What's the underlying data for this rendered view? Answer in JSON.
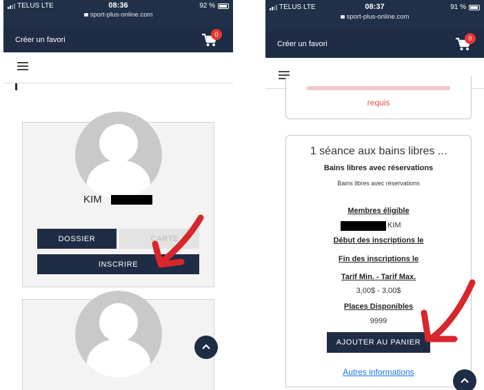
{
  "left": {
    "status": {
      "carrier": "TELUS LTE",
      "time": "08:36",
      "battery": "92 %",
      "url": "sport-plus-online.com"
    },
    "nav": {
      "favorite_label": "Créer un favori",
      "cart_count": "0"
    },
    "member": {
      "name": "KIM"
    },
    "buttons": {
      "dossier": "DOSSIER",
      "carte": "CARTE",
      "inscrire": "INSCRIRE"
    }
  },
  "right": {
    "status": {
      "carrier": "TELUS LTE",
      "time": "08:37",
      "battery": "91 %",
      "url": "sport-plus-online.com"
    },
    "nav": {
      "favorite_label": "Créer un favori",
      "cart_count": "0"
    },
    "top_card": {
      "required_text": "requis"
    },
    "activity": {
      "title": "1 séance aux bains libres ...",
      "subtitle": "Bains libres avec réservations",
      "description": "Bains libres avec réservations",
      "members_label": "Membres éligible",
      "member_name": "KIM",
      "start_label": "Début des inscriptions le",
      "end_label": "Fin des inscriptions le",
      "tarif_label": "Tarif Min. - Tarif Max.",
      "tarif_value": "3,00$ - 3,00$",
      "places_label": "Places Disponibles",
      "places_value": "9999",
      "add_button": "AJOUTER AU PANIER",
      "more_link": "Autres informations"
    }
  },
  "colors": {
    "navy": "#1e2c46",
    "accent_red": "#e53935",
    "card_bg": "#f3f3f3",
    "link_blue": "#1a73e8",
    "warning_red": "#d9534f"
  }
}
